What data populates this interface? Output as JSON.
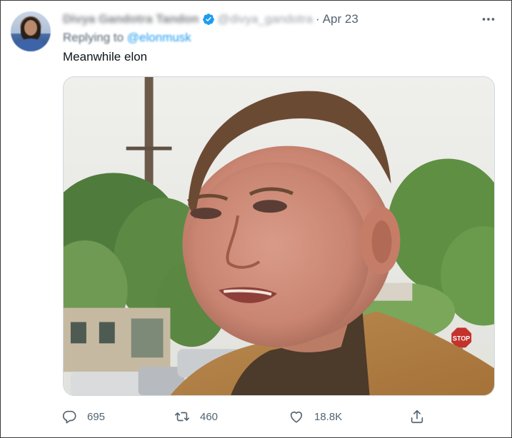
{
  "tweet": {
    "display_name": "Divya Gandotra Tandon",
    "handle": "@divya_gandotra",
    "separator": "·",
    "date": "Apr 23",
    "reply_prefix": "Replying to",
    "reply_to": "@elonmusk",
    "text": "Meanwhile elon",
    "media_icon": "photo"
  },
  "actions": {
    "reply": {
      "icon": "reply-icon",
      "count": "695"
    },
    "retweet": {
      "icon": "retweet-icon",
      "count": "460"
    },
    "like": {
      "icon": "heart-icon",
      "count": "18.8K"
    },
    "share": {
      "icon": "share-icon"
    }
  },
  "colors": {
    "accent": "#1d9bf0",
    "secondary_text": "#536471",
    "primary_text": "#0f1419"
  }
}
